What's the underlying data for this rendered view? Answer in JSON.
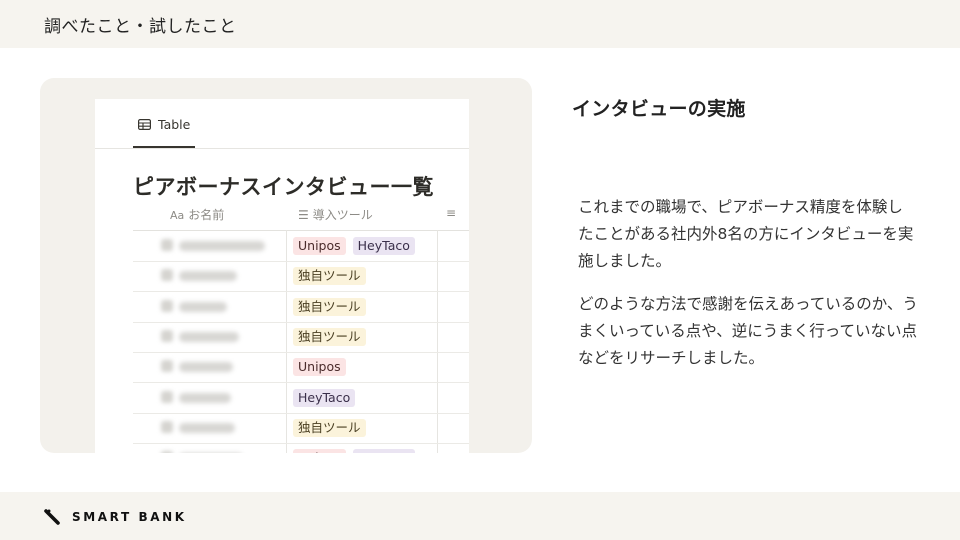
{
  "header": {
    "title": "調べたこと・試したこと"
  },
  "footer": {
    "logo_text": "SMART BANK",
    "logo_icon": "smartbank-mark-icon"
  },
  "screenshot": {
    "view_tab": {
      "label": "Table",
      "icon": "table-icon"
    },
    "title": "ピアボーナスインタビュー一覧",
    "columns": [
      {
        "icon_label": "Aa",
        "label": "お名前"
      },
      {
        "icon_label": "☰",
        "label": "導入ツール"
      },
      {
        "icon_label": "≡",
        "label": ""
      }
    ],
    "rows": [
      {
        "tools": [
          "Unipos",
          "HeyTaco"
        ]
      },
      {
        "tools": [
          "独自ツール"
        ]
      },
      {
        "tools": [
          "独自ツール"
        ]
      },
      {
        "tools": [
          "独自ツール"
        ]
      },
      {
        "tools": [
          "Unipos"
        ]
      },
      {
        "tools": [
          "HeyTaco"
        ]
      },
      {
        "tools": [
          "独自ツール"
        ]
      },
      {
        "tools": [
          "Unipos",
          "HeyTaco"
        ]
      }
    ],
    "tag_colors": {
      "Unipos": "#fbe4e4",
      "HeyTaco": "#eae4f2",
      "独自ツール": "#fbf3db"
    }
  },
  "section": {
    "title": "インタビューの実施",
    "paragraph_1": "これまでの職場で、ピアボーナス精度を体験したことがある社内外8名の方にインタビューを実施しました。",
    "paragraph_2": "どのような方法で感謝を伝えあっているのか、うまくいっている点や、逆にうまく行っていない点などをリサーチしました。"
  }
}
